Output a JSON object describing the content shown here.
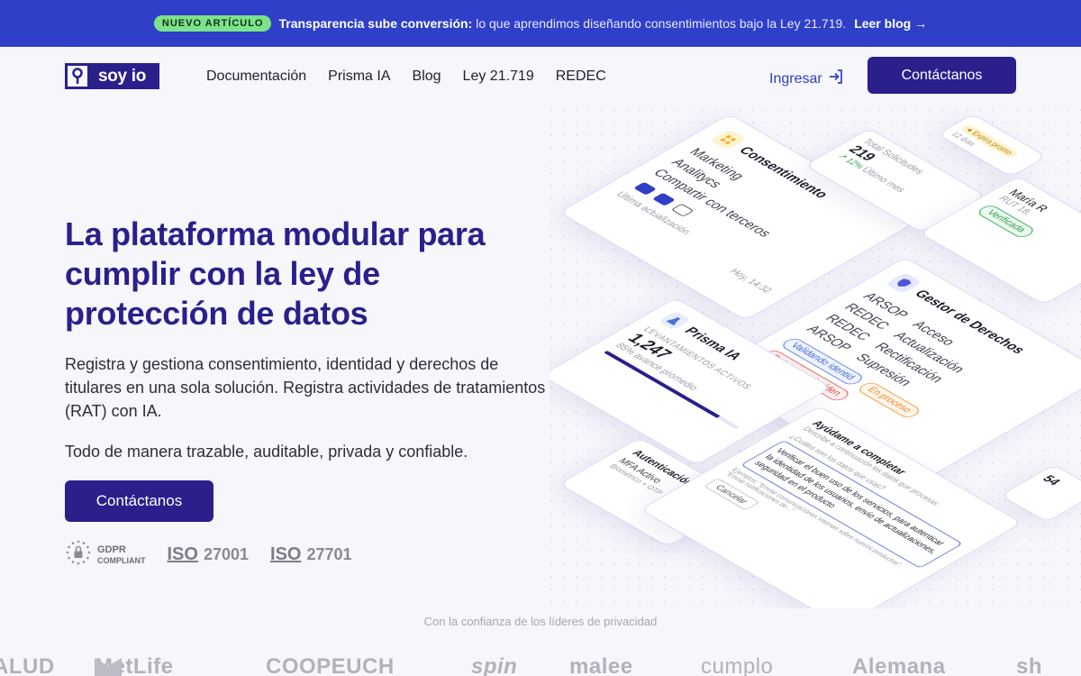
{
  "announcement": {
    "pill": "NUEVO ARTÍCULO",
    "lead": "Transparencia sube conversión:",
    "text": "lo que aprendimos diseñando consentimientos bajo la Ley 21.719.",
    "cta": "Leer blog →"
  },
  "nav": {
    "logo_text": "soy io",
    "links": [
      "Documentación",
      "Prisma IA",
      "Blog",
      "Ley 21.719",
      "REDEC"
    ],
    "login": "Ingresar",
    "contact": "Contáctanos"
  },
  "hero": {
    "title": "La plataforma modular para cumplir con la ley de protección de datos",
    "description": "Registra y gestiona consentimiento, identidad y derechos de titulares en una sola solución. Registra actividades de tratamientos (RAT) con IA.",
    "description2": "Todo de manera trazable, auditable, privada y confiable.",
    "cta": "Contáctanos"
  },
  "badges": {
    "gdpr_line1": "GDPR",
    "gdpr_line2": "COMPLIANT",
    "iso1_word": "ISO",
    "iso1_num": "27001",
    "iso2_word": "ISO",
    "iso2_num": "27701"
  },
  "illustration": {
    "consent": {
      "title": "Consentimiento",
      "items": [
        "Marketing",
        "Analitycs",
        "Compartir con terceros"
      ],
      "updated_label": "Última actualización",
      "updated_value": "Hoy, 14:32"
    },
    "requests": {
      "label": "Total Solicitudes",
      "value": "219",
      "delta": "↗ 12%",
      "delta_note": "Último mes"
    },
    "expire": {
      "badge": "● Expira pronto",
      "note": "12 días"
    },
    "identity": {
      "name": "María R",
      "rut": "RUT 18.",
      "status": "Verificada"
    },
    "rights": {
      "title": "Gestor de Derechos",
      "rows": [
        [
          "ARSOP",
          "Acceso"
        ],
        [
          "REDEC",
          "Actualización"
        ],
        [
          "REDEC",
          "Rectificación"
        ],
        [
          "ARSOP",
          "Supresión"
        ]
      ],
      "pills": [
        "Validando identid",
        "En proceso",
        "Datos no coinciden"
      ],
      "side_value": "54"
    },
    "prisma": {
      "title": "Prisma IA",
      "label": "LEVANTAMIENTOS ACTIVOS",
      "value": "1,247",
      "progress_label": "85% avance promedio",
      "progress": 0.85
    },
    "auth": {
      "title": "Autenticación",
      "item": "MFA Activo",
      "detail": "Biométrico + OTP"
    },
    "assistant": {
      "title": "Ayúdame a completar",
      "subtitle": "Describe a continuación los datos que procesas",
      "question": "¿Cuáles son los datos que usas?",
      "answer": "Verificar el buen uso de los servicios, para autenticar la identidad de los usuarios, envío de actualizaciones, seguridad en el producto",
      "example": "Ejemplos: \"Enviar comunicaciones internas sobre nuevos productos\", \"Enviar notificaciones de...\"",
      "cancel": "Cancelar"
    }
  },
  "trust": {
    "label": "Con la confianza de los líderes de privacidad",
    "logos": [
      "ALUD",
      "MetLife",
      "COOPEUCH",
      "spin",
      "malee",
      "cumplo",
      "Alemana",
      "sh"
    ]
  },
  "colors": {
    "brand": "#2b1f8c",
    "announcement_bg": "#2f3fc8",
    "pill_green": "#7ce38a",
    "link_blue": "#2f3fc8"
  }
}
